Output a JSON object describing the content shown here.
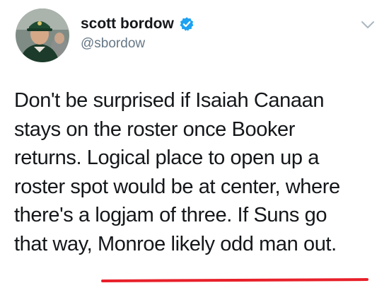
{
  "tweet": {
    "author": {
      "display_name": "scott bordow",
      "handle": "@sbordow",
      "verified_icon": "verified-badge-icon",
      "avatar_icon": "profile-photo"
    },
    "menu_icon": "chevron-down-icon",
    "text_lines": [
      "Don't be surprised if Isaiah Canaan",
      "stays on the roster once Booker",
      "returns. Logical place to open up a",
      "roster spot would be at center, where",
      "there's a logjam of three. If Suns go",
      "that way, Monroe likely odd man out."
    ],
    "annotation": {
      "type": "red hand-drawn underline",
      "underlined_text": "Monroe likely odd man out."
    },
    "colors": {
      "text": "#14171a",
      "handle": "#657786",
      "verified": "#1da1f2",
      "underline": "#e8202a"
    }
  }
}
